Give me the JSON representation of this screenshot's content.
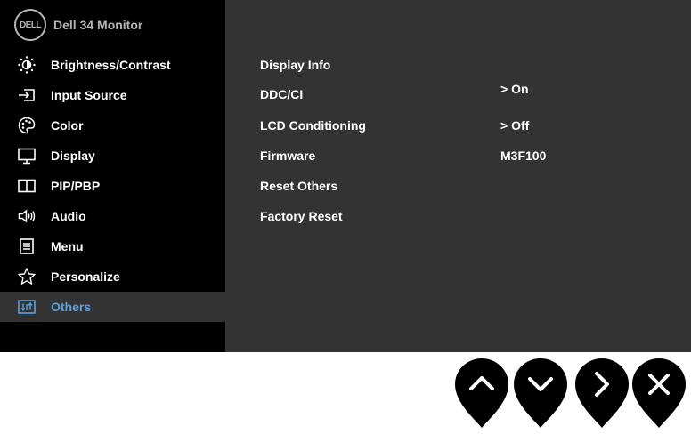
{
  "header": {
    "logo_text": "DELL",
    "title": "Dell  34 Monitor"
  },
  "sidebar": {
    "items": [
      {
        "label": "Brightness/Contrast",
        "icon": "brightness-icon"
      },
      {
        "label": "Input Source",
        "icon": "input-source-icon"
      },
      {
        "label": "Color",
        "icon": "palette-icon"
      },
      {
        "label": "Display",
        "icon": "display-icon"
      },
      {
        "label": "PIP/PBP",
        "icon": "pip-pbp-icon"
      },
      {
        "label": "Audio",
        "icon": "speaker-icon"
      },
      {
        "label": "Menu",
        "icon": "menu-icon"
      },
      {
        "label": "Personalize",
        "icon": "star-icon"
      },
      {
        "label": "Others",
        "icon": "others-icon",
        "active": true
      }
    ]
  },
  "main": {
    "options": [
      {
        "label": "Display Info",
        "value": ""
      },
      {
        "label": "DDC/CI",
        "value": "> On"
      },
      {
        "label": "LCD Conditioning",
        "value": "> Off"
      },
      {
        "label": "Firmware",
        "value": "M3F100"
      },
      {
        "label": "Reset Others",
        "value": ""
      },
      {
        "label": "Factory Reset",
        "value": ""
      }
    ]
  },
  "buttons": [
    {
      "icon": "up-arrow-icon"
    },
    {
      "icon": "down-arrow-icon"
    },
    {
      "icon": "right-arrow-icon"
    },
    {
      "icon": "close-icon"
    }
  ],
  "colors": {
    "sidebar_bg": "#000000",
    "content_bg": "#333333",
    "active_item_text": "#5ba0de",
    "text": "#ffffff",
    "brand_text": "#b5b5b5"
  }
}
